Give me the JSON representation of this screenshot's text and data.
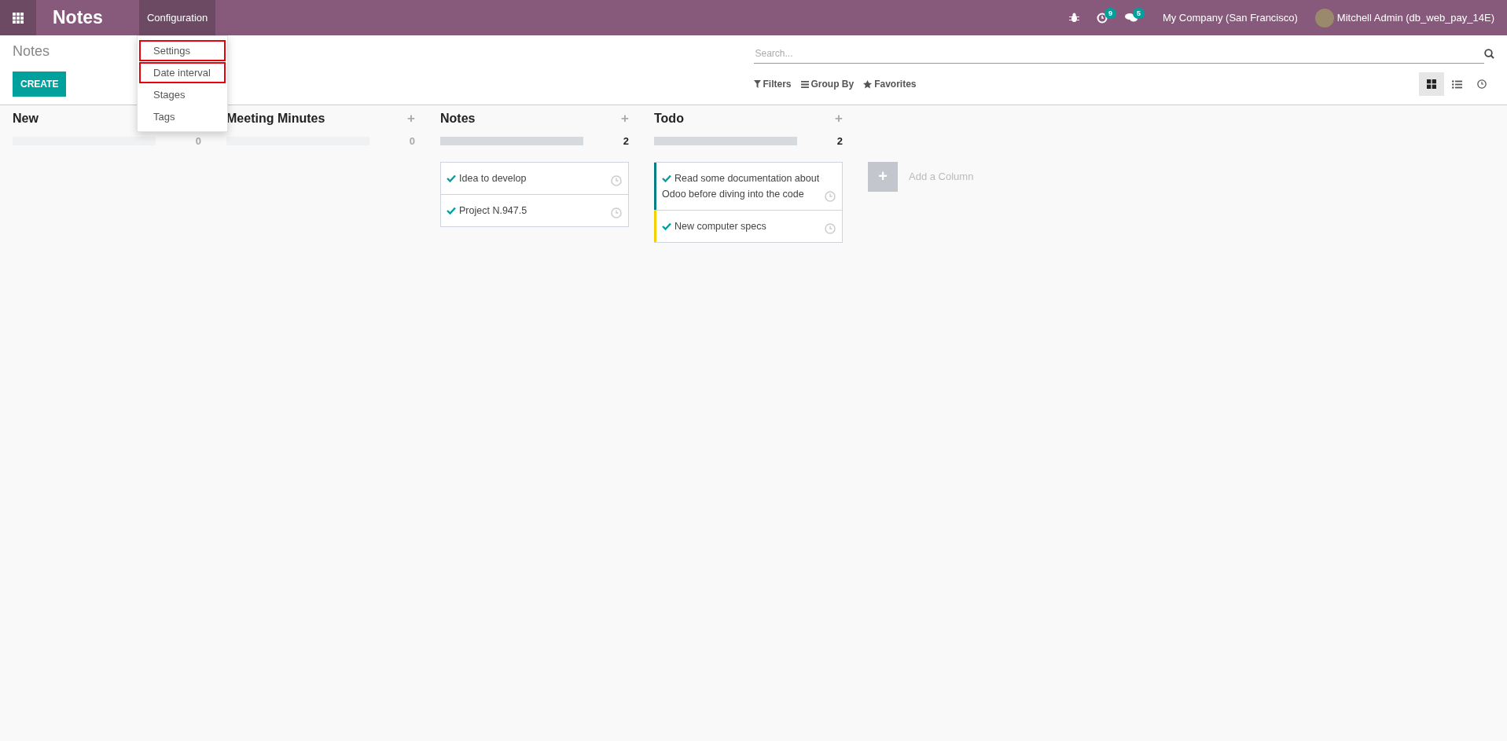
{
  "navbar": {
    "app_name": "Notes",
    "menus": [
      {
        "label": "Configuration",
        "selected": true
      }
    ],
    "activity_count": "9",
    "message_count": "5",
    "company": "My Company (San Francisco)",
    "user": "Mitchell Admin (db_web_pay_14E)"
  },
  "dropdown": {
    "items": [
      {
        "label": "Settings",
        "highlighted": true
      },
      {
        "label": "Date interval",
        "highlighted": true
      },
      {
        "label": "Stages",
        "highlighted": false
      },
      {
        "label": "Tags",
        "highlighted": false
      }
    ]
  },
  "control_panel": {
    "breadcrumb": "Notes",
    "create_button": "CREATE",
    "search": {
      "placeholder": "Search..."
    },
    "filters": [
      "Filters",
      "Group By",
      "Favorites"
    ],
    "views": [
      {
        "kind": "kanban",
        "selected": true
      },
      {
        "kind": "list",
        "selected": false
      },
      {
        "kind": "activity",
        "selected": false
      }
    ]
  },
  "kanban": {
    "columns": [
      {
        "title": "New",
        "count": "0",
        "filled": false
      },
      {
        "title": "Meeting Minutes",
        "add_label": "+",
        "count": "0",
        "filled": false
      },
      {
        "title": "Notes",
        "add_label": "+",
        "count": "2",
        "filled": true,
        "cards": [
          {
            "text": "Idea to develop"
          },
          {
            "text": "Project N.947.5"
          }
        ]
      },
      {
        "title": "Todo",
        "add_label": "+",
        "count": "2",
        "filled": true,
        "cards": [
          {
            "text": "Read some documentation about Odoo before diving into the code",
            "color": "#017e84"
          },
          {
            "text": "New computer specs",
            "color": "#f4d000"
          }
        ]
      }
    ],
    "add_column_symbol": "+",
    "add_column": "Add a Column"
  }
}
